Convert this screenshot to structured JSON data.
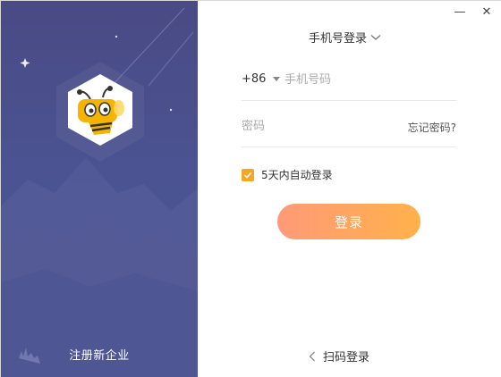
{
  "window": {
    "minimize_glyph": "—",
    "close_glyph": "✕"
  },
  "left_panel": {
    "register_label": "注册新企业",
    "logo_icon": "bee-mascot-icon"
  },
  "login_mode": {
    "label": "手机号登录",
    "icon": "chevron-down-icon"
  },
  "phone_field": {
    "country_code": "+86",
    "placeholder": "手机号码",
    "value": ""
  },
  "password_field": {
    "placeholder": "密码",
    "value": ""
  },
  "forgot_password": "忘记密码?",
  "remember": {
    "label": "5天内自动登录",
    "checked": true
  },
  "login_button": "登录",
  "qr_login": {
    "label": "扫码登录",
    "icon": "chevron-left-icon"
  },
  "colors": {
    "accent": "#f5a623",
    "button_start": "#ff9a78",
    "button_end": "#ffb14a",
    "left_panel": "#4b5392"
  }
}
